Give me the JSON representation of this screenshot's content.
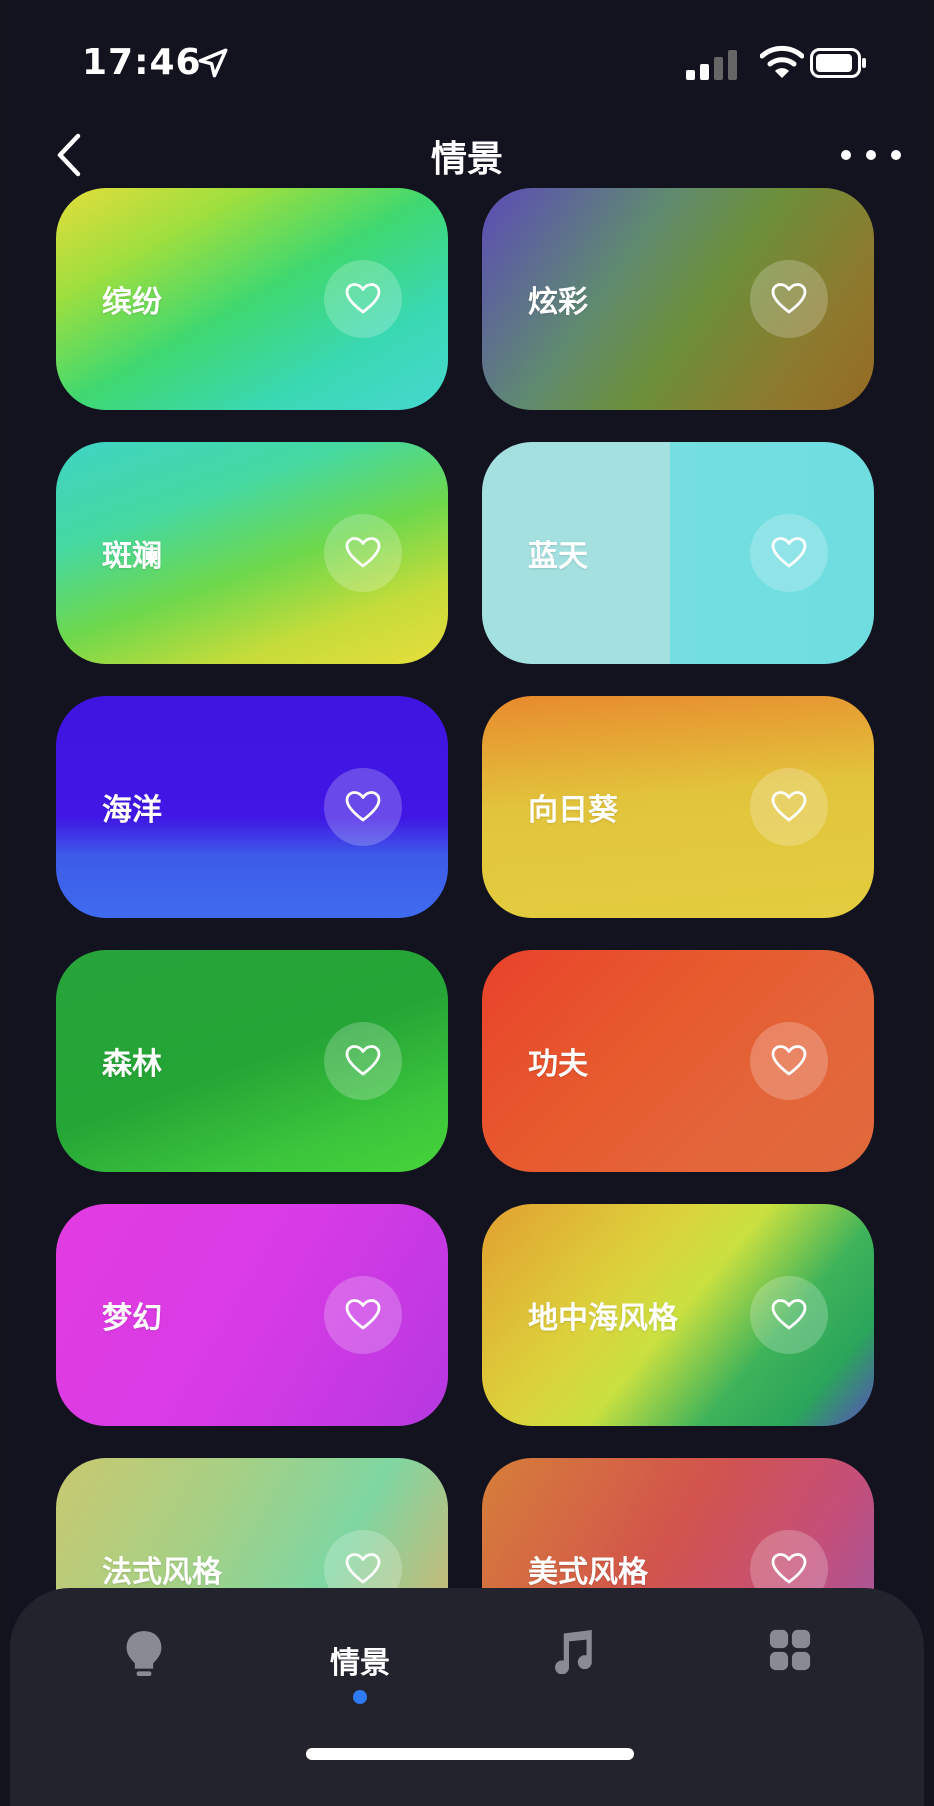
{
  "status_bar": {
    "time": "17:46"
  },
  "nav": {
    "title": "情景"
  },
  "scenes": [
    {
      "name": "缤纷"
    },
    {
      "name": "炫彩"
    },
    {
      "name": "斑斓"
    },
    {
      "name": "蓝天"
    },
    {
      "name": "海洋"
    },
    {
      "name": "向日葵"
    },
    {
      "name": "森林"
    },
    {
      "name": "功夫"
    },
    {
      "name": "梦幻"
    },
    {
      "name": "地中海风格"
    },
    {
      "name": "法式风格"
    },
    {
      "name": "美式风格"
    }
  ],
  "tabs": [
    {
      "icon": "bulb-icon",
      "label": ""
    },
    {
      "icon": "",
      "label": "情景",
      "active": true
    },
    {
      "icon": "music-icon",
      "label": ""
    },
    {
      "icon": "grid-icon",
      "label": ""
    }
  ],
  "colors": {
    "accent": "#2f7bf5",
    "background": "#13131f",
    "tab_bar": "#23232e"
  }
}
